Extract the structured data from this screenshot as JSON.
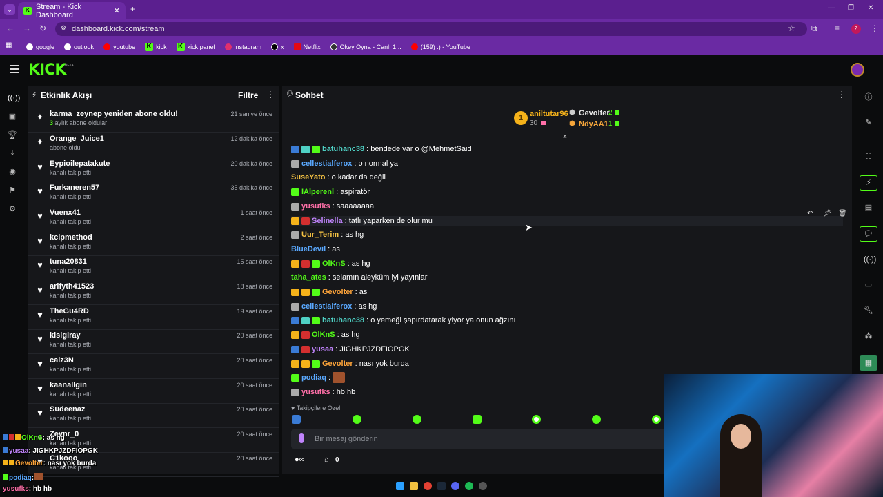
{
  "browser": {
    "tab_title": "Stream - Kick Dashboard",
    "url": "dashboard.kick.com/stream",
    "profile_initial": "Z",
    "bookmarks": [
      "google",
      "outlook",
      "youtube",
      "kick",
      "kick panel",
      "instagram",
      "x",
      "Netflix",
      "Okey Oyna - Canlı 1...",
      "(159) :) - YouTube"
    ]
  },
  "header": {
    "logo": "KICK",
    "beta": "BETA"
  },
  "activity": {
    "title": "Etkinlik Akışı",
    "filter_label": "Filtre",
    "events": [
      {
        "name": "karma_zeynep yeniden abone oldu!",
        "sub_highlight": "3",
        "sub": " aylık abone oldular",
        "time": "21 saniye önce",
        "icon": "sparkle"
      },
      {
        "name": "Orange_Juice1",
        "sub": "abone oldu",
        "time": "12 dakika önce",
        "icon": "sparkle"
      },
      {
        "name": "Eypioilepatakute",
        "sub": "kanalı takip etti",
        "time": "20 dakika önce",
        "icon": "heart"
      },
      {
        "name": "Furkaneren57",
        "sub": "kanalı takip etti",
        "time": "35 dakika önce",
        "icon": "heart"
      },
      {
        "name": "Vuenx41",
        "sub": "kanalı takip etti",
        "time": "1 saat önce",
        "icon": "heart"
      },
      {
        "name": "kcipmethod",
        "sub": "kanalı takip etti",
        "time": "2 saat önce",
        "icon": "heart"
      },
      {
        "name": "tuna20831",
        "sub": "kanalı takip etti",
        "time": "15 saat önce",
        "icon": "heart"
      },
      {
        "name": "arifyth41523",
        "sub": "kanalı takip etti",
        "time": "18 saat önce",
        "icon": "heart"
      },
      {
        "name": "TheGu4RD",
        "sub": "kanalı takip etti",
        "time": "19 saat önce",
        "icon": "heart"
      },
      {
        "name": "kisigiray",
        "sub": "kanalı takip etti",
        "time": "20 saat önce",
        "icon": "heart"
      },
      {
        "name": "calz3N",
        "sub": "kanalı takip etti",
        "time": "20 saat önce",
        "icon": "heart"
      },
      {
        "name": "kaanallgin",
        "sub": "kanalı takip etti",
        "time": "20 saat önce",
        "icon": "heart"
      },
      {
        "name": "Sudeenaz",
        "sub": "kanalı takip etti",
        "time": "20 saat önce",
        "icon": "heart"
      },
      {
        "name": "Zeynr_0",
        "sub": "kanalı takip etti",
        "time": "20 saat önce",
        "icon": "heart"
      },
      {
        "name": "C1kooo",
        "sub": "kanalı takip etti",
        "time": "20 saat önce",
        "icon": "heart"
      }
    ]
  },
  "chat": {
    "title": "Sohbet",
    "leaderboard": {
      "first_name": "aniltutar96",
      "first_count": "30",
      "second_name": "Gevolter",
      "second_count": "2",
      "third_name": "NdyAA1",
      "third_count": "1",
      "rank": "1"
    },
    "messages": [
      {
        "user": "batuhanc38",
        "color": "#4fd1c5",
        "text": ": bendede var o @MehmetSaid"
      },
      {
        "user": "cellestialferox",
        "color": "#5aa9ff",
        "text": ": o normal ya"
      },
      {
        "user": "SuseYato",
        "color": "#f6c343",
        "text": ": o kadar da değil"
      },
      {
        "user": "IAlperenl",
        "color": "#53fc18",
        "text": ": aspiratör"
      },
      {
        "user": "yusufks",
        "color": "#ff6fa8",
        "text": ": saaaaaaaa"
      },
      {
        "user": "Selinella",
        "color": "#c084fc",
        "text": ": tatlı yaparken de olur mu"
      },
      {
        "user": "Uur_Terim",
        "color": "#f6c343",
        "text": ": as hg"
      },
      {
        "user": "BlueDevil",
        "color": "#5aa9ff",
        "text": ": as"
      },
      {
        "user": "OlKnS",
        "color": "#53fc18",
        "text": ": as hg"
      },
      {
        "user": "taha_ates",
        "color": "#53fc18",
        "text": ": selamın aleyküm iyi yayınlar"
      },
      {
        "user": "Gevolter",
        "color": "#ffa53a",
        "text": ": as"
      },
      {
        "user": "cellestialferox",
        "color": "#5aa9ff",
        "text": ": as hg"
      },
      {
        "user": "batuhanc38",
        "color": "#4fd1c5",
        "text": ": o yemeği şapırdatarak yiyor ya onun ağzını"
      },
      {
        "user": "OlKnS",
        "color": "#53fc18",
        "text": ": as hg"
      },
      {
        "user": "yusaa",
        "color": "#c084fc",
        "text": ": JIGHKPJZDFIOPGK"
      },
      {
        "user": "Gevolter",
        "color": "#ffa53a",
        "text": ": nası yok burda"
      },
      {
        "user": "podiaq",
        "color": "#5aa9ff",
        "text": ":"
      },
      {
        "user": "yusufks",
        "color": "#ff6fa8",
        "text": ": hb hb"
      }
    ],
    "followers_only": "Takipçilere Özel",
    "input_placeholder": "Bir mesaj gönderin",
    "points": "0"
  },
  "overlay": [
    {
      "user": "OlKnS",
      "color": "#53fc18",
      "text": ": as hg"
    },
    {
      "user": "yusaa",
      "color": "#c084fc",
      "text": ": JIGHKPJZDFIOPGK"
    },
    {
      "user": "Gevolter",
      "color": "#ffa53a",
      "text": ": nası yok burda"
    },
    {
      "user": "podiaq",
      "color": "#5aa9ff",
      "text": ":"
    },
    {
      "user": "yusufks",
      "color": "#ff6fa8",
      "text": ": hb hb"
    }
  ]
}
